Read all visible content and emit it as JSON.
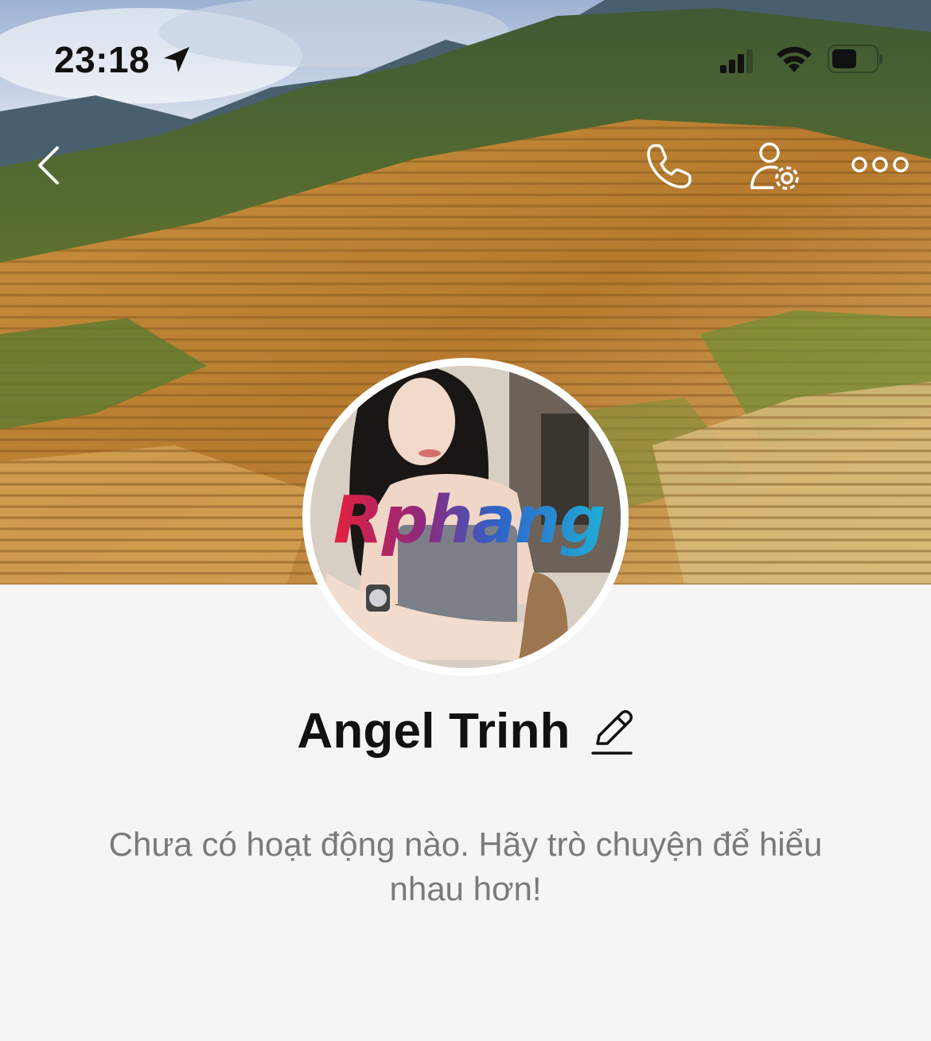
{
  "status_bar": {
    "time": "23:18",
    "icons": [
      "location-arrow-icon",
      "cellular-signal-icon",
      "wifi-icon",
      "battery-icon"
    ]
  },
  "nav": {
    "icons": [
      "back-chevron-icon",
      "phone-icon",
      "user-settings-icon",
      "more-dots-icon"
    ]
  },
  "profile": {
    "name": "Angel Trinh",
    "avatar_watermark": "Rphang",
    "edit_icon": "pencil-icon"
  },
  "activity": {
    "empty_message": "Chưa có hoạt động nào. Hãy trò chuyện để hiểu nhau hơn!"
  },
  "colors": {
    "background": "#f5f5f5",
    "text_primary": "#111111",
    "text_secondary": "#7a7a7a",
    "icon_light": "#ffffff"
  }
}
